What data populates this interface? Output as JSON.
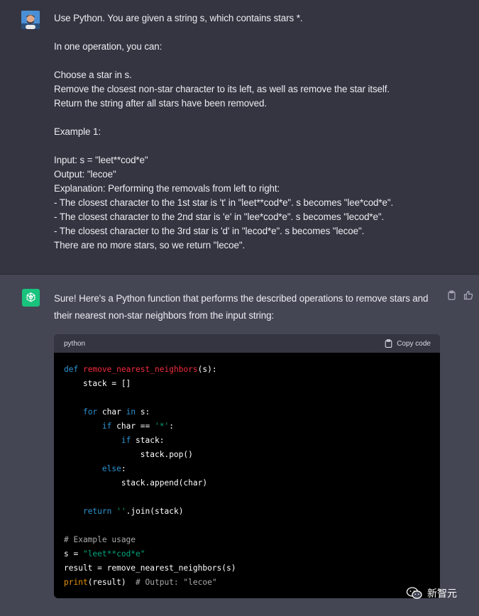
{
  "user": {
    "message": "Use Python. You are given a string s, which contains stars *.\n\nIn one operation, you can:\n\nChoose a star in s.\nRemove the closest non-star character to its left, as well as remove the star itself.\nReturn the string after all stars have been removed.\n\nExample 1:\n\nInput: s = \"leet**cod*e\"\nOutput: \"lecoe\"\nExplanation: Performing the removals from left to right:\n- The closest character to the 1st star is 't' in \"leet**cod*e\". s becomes \"lee*cod*e\".\n- The closest character to the 2nd star is 'e' in \"lee*cod*e\". s becomes \"lecod*e\".\n- The closest character to the 3rd star is 'd' in \"lecod*e\". s becomes \"lecoe\".\nThere are no more stars, so we return \"lecoe\"."
  },
  "assistant": {
    "intro": "Sure! Here's a Python function that performs the described operations to remove stars and their nearest non-star neighbors from the input string:",
    "code_language": "python",
    "copy_label": "Copy code",
    "code": {
      "l1_kw": "def",
      "l1_fn": "remove_nearest_neighbors",
      "l1_rest": "(s):",
      "l2": "    stack = []",
      "l4_kw": "for",
      "l4_a": " char ",
      "l4_kw2": "in",
      "l4_b": " s:",
      "l5_kw": "if",
      "l5_a": " char == ",
      "l5_str": "'*'",
      "l5_b": ":",
      "l6_kw": "if",
      "l6_a": " stack:",
      "l7": "stack.pop()",
      "l8_kw": "else",
      "l8_a": ":",
      "l9": "stack.append(char)",
      "l11_kw": "return",
      "l11_str": "''",
      "l11_a": ".join(stack)",
      "l13_cm": "# Example usage",
      "l14_a": "s = ",
      "l14_str": "\"leet**cod*e\"",
      "l15": "result = remove_nearest_neighbors(s)",
      "l16_bi": "print",
      "l16_a": "(result)  ",
      "l16_cm": "# Output: \"lecoe\""
    }
  },
  "watermark": {
    "text": "新智元"
  },
  "colors": {
    "gpt_avatar": "#19c37d",
    "user_bg": "#343541",
    "assistant_bg": "#444654"
  }
}
